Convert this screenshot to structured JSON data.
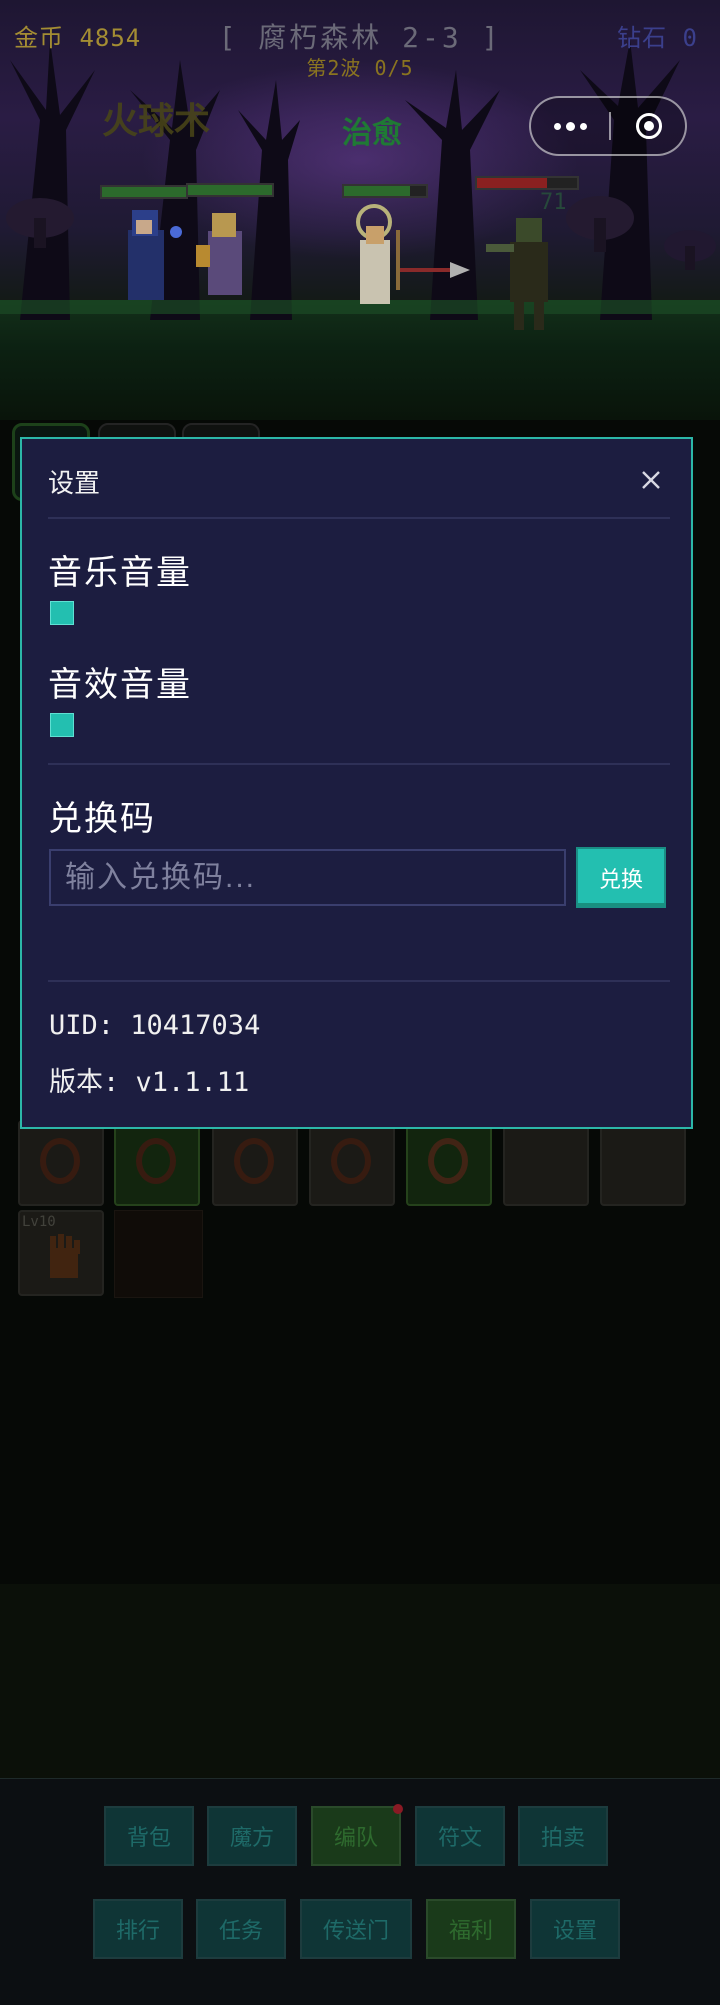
{
  "hud": {
    "gold": "金币 4854",
    "stage": "[ 腐朽森林 2-3 ]",
    "wave": "第2波 0/5",
    "diamond": "钻石 0"
  },
  "battle": {
    "floating_skill_1": "火球术",
    "floating_skill_2": "治愈",
    "damage_number": "71"
  },
  "background_ui": {
    "equipment_level_label": "Lv10",
    "nav_row1": [
      "背包",
      "魔方",
      "编队",
      "符文",
      "拍卖"
    ],
    "nav_row2": [
      "排行",
      "任务",
      "传送门",
      "福利",
      "设置"
    ]
  },
  "modal": {
    "title": "设置",
    "music_label": "音乐音量",
    "sfx_label": "音效音量",
    "music_volume": 0,
    "sfx_volume": 0,
    "redeem_label": "兑换码",
    "redeem_placeholder": "输入兑换码...",
    "redeem_button": "兑换",
    "uid_line": "UID: 10417034",
    "version_line": "版本: v1.1.11"
  },
  "colors": {
    "modal_bg": "#1c1d40",
    "modal_border": "#2cb7a8",
    "accent_teal": "#23bfb0",
    "gold_text": "#a48d33",
    "heal_text": "#1f7a34"
  },
  "icons": {
    "close": "close-icon",
    "capsule_more": "more-dots-icon",
    "capsule_exit": "target-icon"
  }
}
